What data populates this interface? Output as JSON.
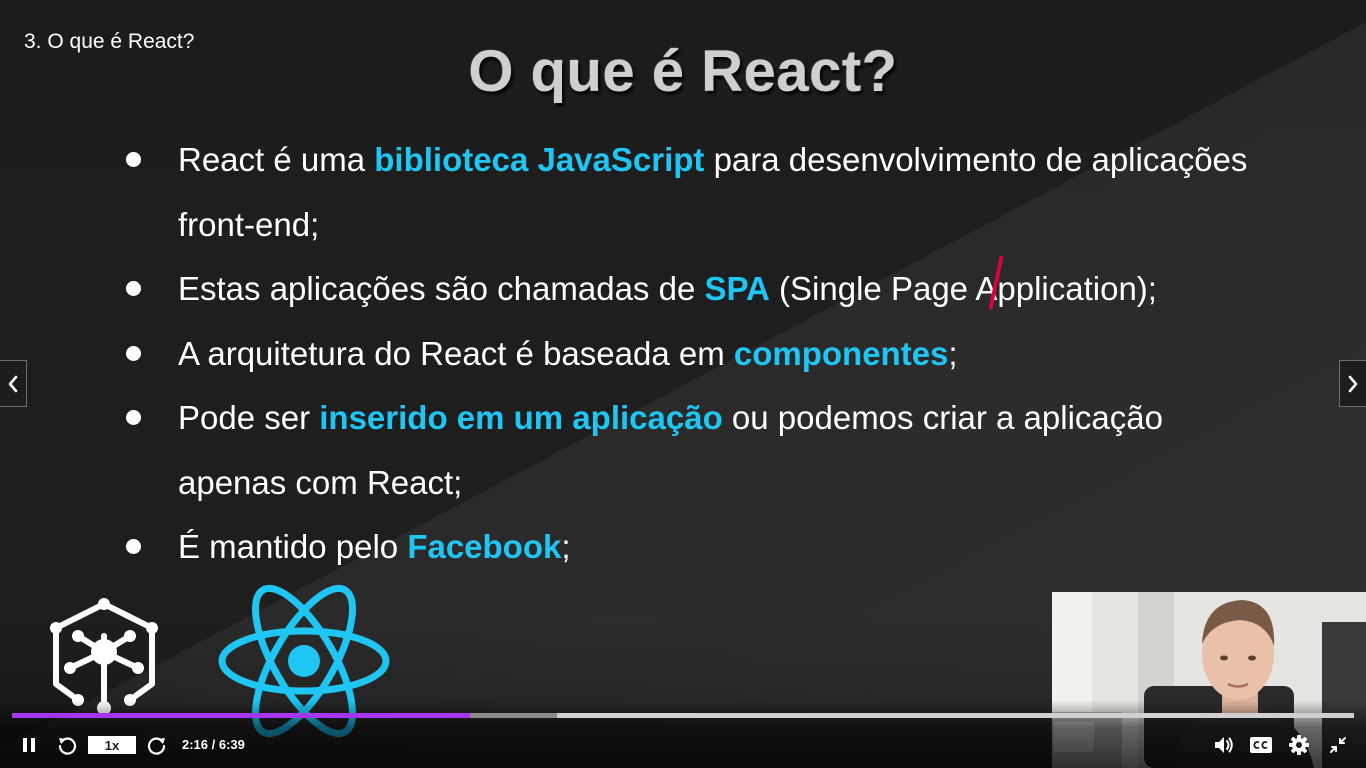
{
  "lecture": {
    "title": "3. O que é React?"
  },
  "slide": {
    "title": "O que é React?",
    "bullets": [
      {
        "lines": [
          [
            {
              "t": "React é uma "
            },
            {
              "t": "biblioteca JavaScript",
              "hl": true
            },
            {
              "t": " para desenvolvimento de aplicações"
            }
          ],
          [
            {
              "t": "front-end;"
            }
          ]
        ]
      },
      {
        "lines": [
          [
            {
              "t": "Estas aplicações são chamadas de "
            },
            {
              "t": "SPA",
              "hl": true
            },
            {
              "t": " (Single Page Application);"
            }
          ]
        ]
      },
      {
        "lines": [
          [
            {
              "t": "A arquitetura do React é baseada em "
            },
            {
              "t": "componentes",
              "hl": true
            },
            {
              "t": ";"
            }
          ]
        ]
      },
      {
        "lines": [
          [
            {
              "t": "Pode ser "
            },
            {
              "t": "inserido em um aplicação",
              "hl": true
            },
            {
              "t": " ou podemos criar a aplicação"
            }
          ],
          [
            {
              "t": "apenas com React;"
            }
          ]
        ]
      },
      {
        "lines": [
          [
            {
              "t": "É mantido pelo "
            },
            {
              "t": "Facebook",
              "hl": true
            },
            {
              "t": ";"
            }
          ]
        ]
      }
    ]
  },
  "player": {
    "speed_label": "1x",
    "time_label": "2:16 / 6:39",
    "progress_played": 0.341,
    "progress_buffered": 0.406
  },
  "icons": {
    "prev": "chevron-left-icon",
    "next": "chevron-right-icon",
    "pause": "pause-icon",
    "rewind": "rewind-5-icon",
    "forward": "forward-5-icon",
    "volume": "volume-icon",
    "captions": "captions-icon",
    "settings": "gear-icon",
    "fullscreen_exit": "exit-fullscreen-icon"
  },
  "colors": {
    "highlight": "#1fc6f3",
    "progress": "#a435f0",
    "react_logo": "#1fc6f3"
  }
}
